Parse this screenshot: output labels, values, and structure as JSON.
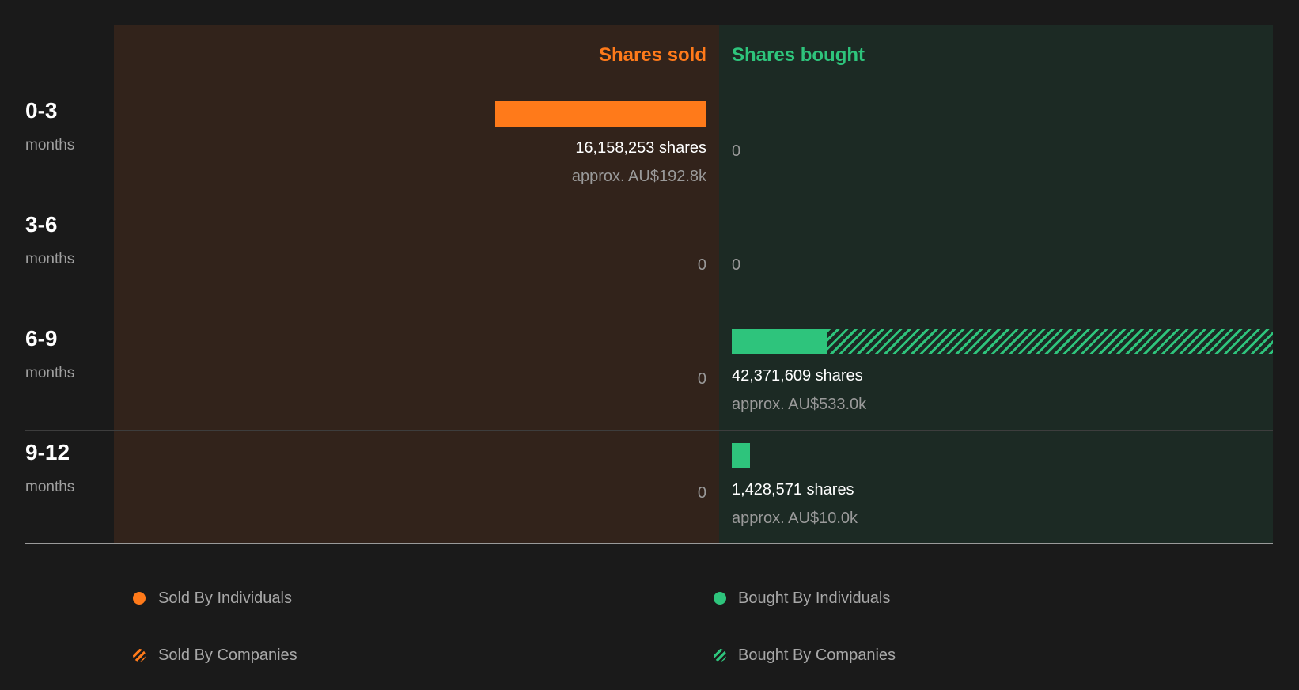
{
  "chart_data": {
    "type": "bar",
    "headers": {
      "sold": "Shares sold",
      "bought": "Shares bought"
    },
    "categories": [
      {
        "period": "0-3",
        "unit": "months"
      },
      {
        "period": "3-6",
        "unit": "months"
      },
      {
        "period": "6-9",
        "unit": "months"
      },
      {
        "period": "9-12",
        "unit": "months"
      }
    ],
    "sold": {
      "individuals": [
        16158253,
        0,
        0,
        0
      ],
      "companies": [
        0,
        0,
        0,
        0
      ],
      "total_labels": [
        "16,158,253 shares",
        "0",
        "0",
        "0"
      ],
      "approx_labels": [
        "approx. AU$192.8k",
        "",
        "",
        ""
      ]
    },
    "bought": {
      "individuals": [
        0,
        0,
        7500000,
        1428571
      ],
      "companies": [
        0,
        0,
        34871609,
        0
      ],
      "total_labels": [
        "0",
        "0",
        "42,371,609 shares",
        "1,428,571 shares"
      ],
      "approx_labels": [
        "",
        "",
        "approx. AU$533.0k",
        "approx. AU$10.0k"
      ]
    },
    "legend": {
      "sold_individuals": "Sold By Individuals",
      "sold_companies": "Sold By Companies",
      "bought_individuals": "Bought By Individuals",
      "bought_companies": "Bought By Companies"
    },
    "colors": {
      "sold": "#ff7a1a",
      "bought": "#2ec47c"
    }
  }
}
